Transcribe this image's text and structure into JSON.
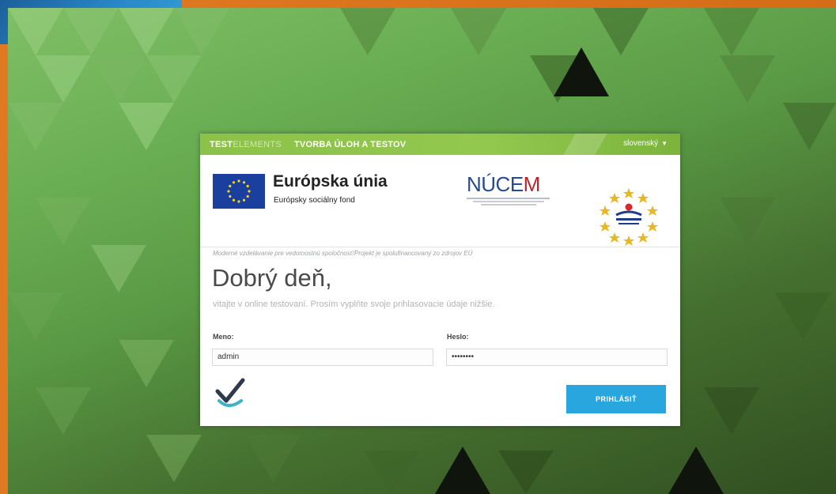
{
  "header": {
    "brand_strong": "TEST",
    "brand_light": "ELEMENTS",
    "subtitle": "TVORBA ÚLOH A TESTOV",
    "language": "slovenský"
  },
  "logos": {
    "eu_title": "Európska únia",
    "eu_subtitle": "Európsky sociálny fond",
    "nucem_prefix": "NÚCE",
    "nucem_suffix": "M",
    "seal_icon": "eu-cofinanced-seal-icon",
    "tagline": "Moderné vzdelávanie pre vedomostnú spoločnosť/Projekt je spolufinancovaný zo zdrojov EÚ"
  },
  "greeting": {
    "title": "Dobrý deň,",
    "subtitle": "vitajte v online testovaní. Prosím vyplňte svoje prihlasovacie údaje nižšie."
  },
  "form": {
    "name_label": "Meno:",
    "name_value": "admin",
    "password_label": "Heslo:",
    "password_value": "••••••••",
    "submit_label": "PRIHLÁSIŤ"
  },
  "colors": {
    "topbar": "#8cc24a",
    "button": "#2aa6de",
    "eu_blue": "#1a3f9e",
    "nucem_blue": "#2a4a8a",
    "nucem_red": "#c8202d",
    "frame_orange": "#e07a22"
  }
}
